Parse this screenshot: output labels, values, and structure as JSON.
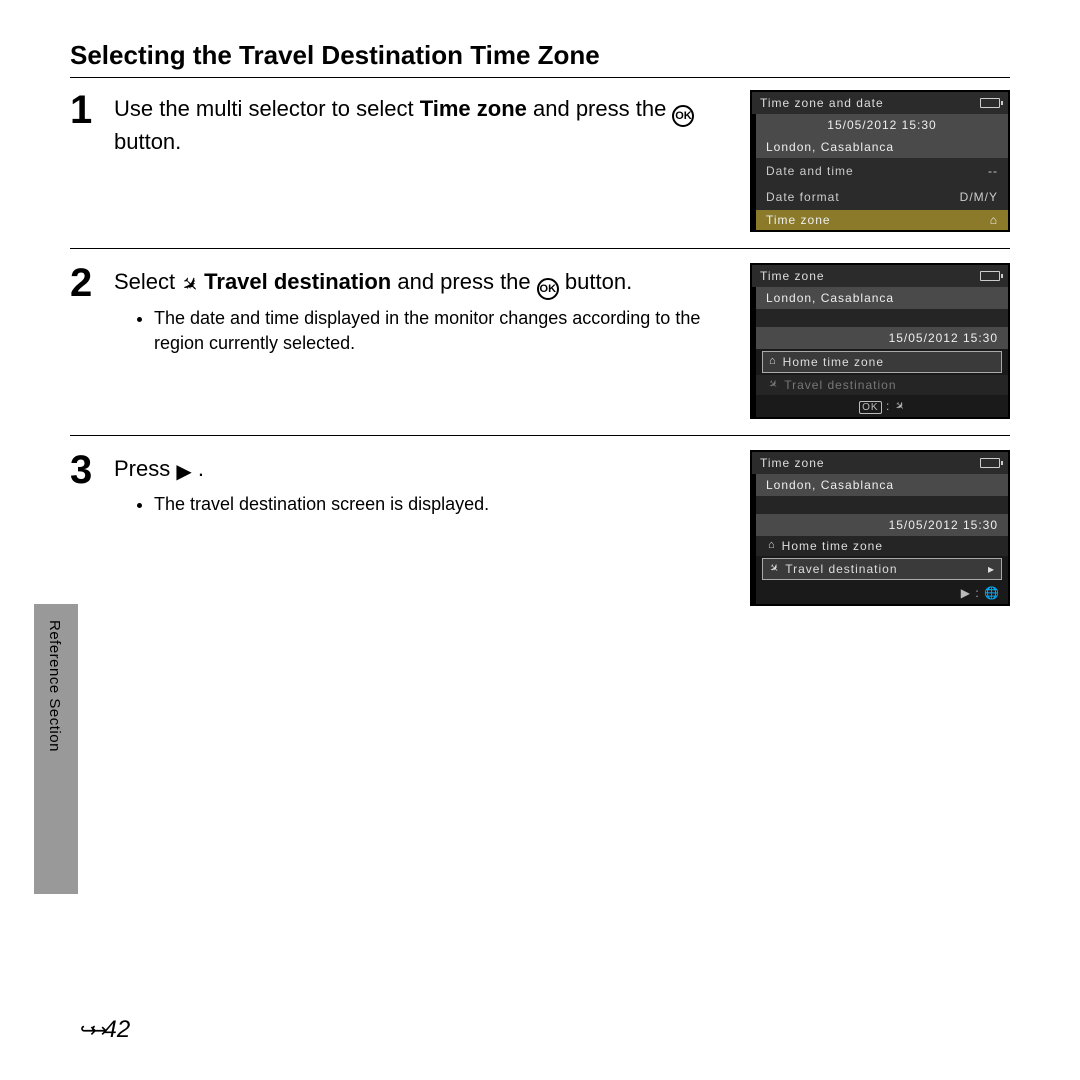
{
  "title": "Selecting the Travel Destination Time Zone",
  "side_label": "Reference Section",
  "page_number": "42",
  "steps": {
    "s1": {
      "num": "1",
      "text_a": "Use the multi selector to select ",
      "bold_a": "Time zone",
      "text_b": " and press the ",
      "ok": "OK",
      "text_c": " button."
    },
    "s2": {
      "num": "2",
      "text_a": "Select ",
      "bold_a": "Travel destination",
      "text_b": " and press the ",
      "ok": "OK",
      "text_c": " button.",
      "bullet": "The date and time displayed in the monitor changes according to the region currently selected."
    },
    "s3": {
      "num": "3",
      "text_a": "Press ",
      "text_b": ".",
      "bullet": "The travel destination screen is displayed."
    }
  },
  "lcd1": {
    "header": "Time zone and date",
    "datetime": "15/05/2012 15:30",
    "region": "London, Casablanca",
    "row_dt_label": "Date and time",
    "row_dt_val": "--",
    "row_df_label": "Date format",
    "row_df_val": "D/M/Y",
    "row_tz_label": "Time zone",
    "row_tz_icon": "⌂"
  },
  "lcd2": {
    "header": "Time zone",
    "region": "London, Casablanca",
    "datetime": "15/05/2012 15:30",
    "home_label": "Home time zone",
    "travel_label": "Travel destination",
    "footer": "OK : ✈"
  },
  "lcd3": {
    "header": "Time zone",
    "region": "London, Casablanca",
    "datetime": "15/05/2012 15:30",
    "home_label": "Home time zone",
    "travel_label": "Travel destination",
    "footer": "▶ : 🌐"
  }
}
